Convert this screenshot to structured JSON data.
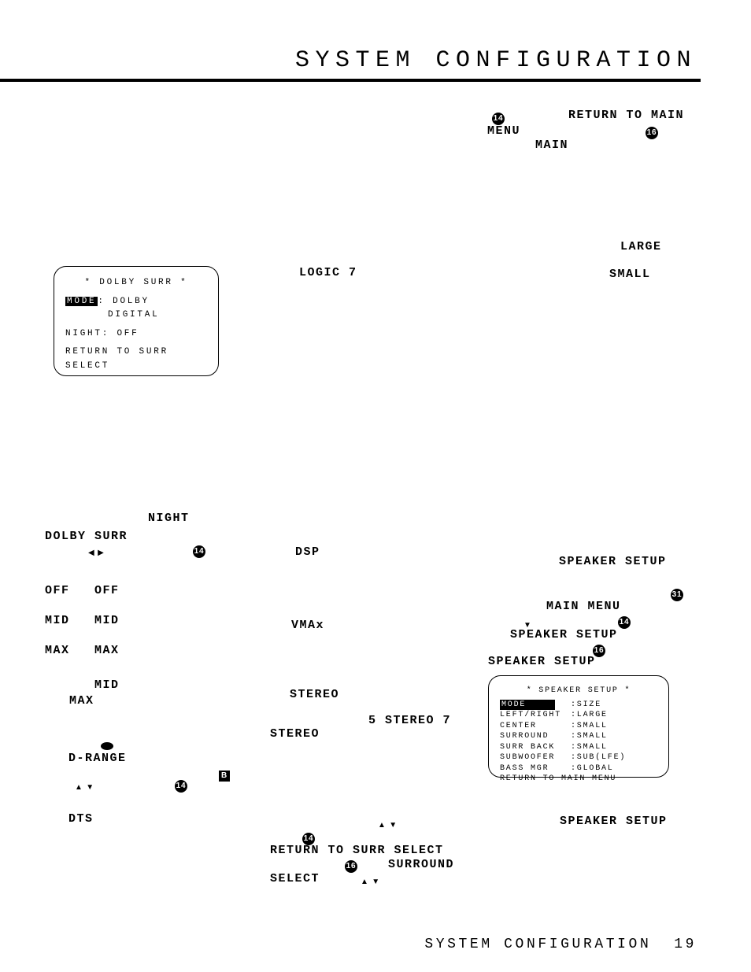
{
  "page": {
    "title": "SYSTEM CONFIGURATION",
    "footer_text": "SYSTEM CONFIGURATION",
    "footer_page": "19"
  },
  "top_right": {
    "num14": "14",
    "return_main": "RETURN TO MAIN",
    "menu": "MENU",
    "num16": "16",
    "main": "MAIN"
  },
  "right_upper": {
    "large": "LARGE",
    "small": "SMALL"
  },
  "osd1": {
    "header": "* DOLBY SURR *",
    "mode_label": "MODE",
    "mode_val": ": DOLBY",
    "mode_val2": "DIGITAL",
    "night": "NIGHT: OFF",
    "return": "RETURN TO SURR SELECT"
  },
  "left_block": {
    "night": "NIGHT",
    "dolby_surr": "DOLBY SURR",
    "num14a": "14",
    "off1": "OFF",
    "off2": "OFF",
    "mid1": "MID",
    "mid2": "MID",
    "max1": "MAX",
    "max2": "MAX",
    "mid3": "MID",
    "max3": "MAX",
    "drange": "D-RANGE",
    "num14b": "14",
    "dts": "DTS"
  },
  "center_block": {
    "logic7": "LOGIC 7",
    "dsp": "DSP",
    "vmax": "VMAx",
    "stereo1": "STEREO",
    "stereo57": "5 STEREO  7",
    "stereo2": "STEREO",
    "b": "B",
    "num14": "14",
    "return_surr": "RETURN TO SURR SELECT",
    "num16": "16",
    "surround": "SURROUND",
    "select": "SELECT"
  },
  "right_block": {
    "speaker_setup1": "SPEAKER SETUP",
    "num31": "31",
    "main_menu": "MAIN MENU",
    "num14": "14",
    "speaker_setup2": "SPEAKER SETUP",
    "num16": "16",
    "speaker_setup3": "SPEAKER SETUP",
    "speaker_setup4": "SPEAKER SETUP"
  },
  "osd2": {
    "header": "* SPEAKER SETUP *",
    "mode_label": "MODE",
    "mode_val": ":SIZE",
    "lr_label": "LEFT/RIGHT",
    "lr_val": ":LARGE",
    "center_label": "CENTER",
    "center_val": ":SMALL",
    "surr_label": "SURROUND",
    "surr_val": ":SMALL",
    "sback_label": "SURR BACK",
    "sback_val": ":SMALL",
    "sub_label": "SUBWOOFER",
    "sub_val": ":SUB(LFE)",
    "bass_label": "BASS MGR",
    "bass_val": ":GLOBAL",
    "return": "RETURN TO MAIN MENU"
  }
}
